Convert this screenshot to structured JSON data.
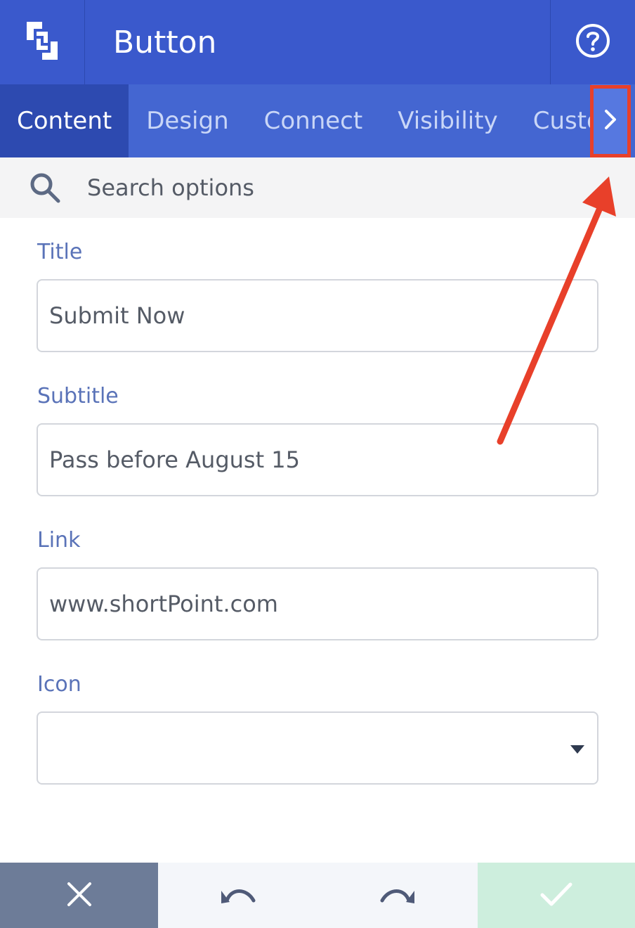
{
  "header": {
    "title": "Button",
    "logo_icon": "shortpoint-logo-icon",
    "help_icon": "help-icon"
  },
  "tabs": [
    {
      "label": "Content",
      "active": true
    },
    {
      "label": "Design",
      "active": false
    },
    {
      "label": "Connect",
      "active": false
    },
    {
      "label": "Visibility",
      "active": false
    },
    {
      "label": "Custo",
      "active": false
    }
  ],
  "tabs_next_icon": "chevron-right-icon",
  "search": {
    "placeholder": "Search options"
  },
  "form": {
    "title": {
      "label": "Title",
      "value": "Submit Now"
    },
    "subtitle": {
      "label": "Subtitle",
      "value": "Pass before August 15"
    },
    "link": {
      "label": "Link",
      "value": "www.shortPoint.com"
    },
    "icon": {
      "label": "Icon",
      "value": ""
    }
  },
  "bottom_bar": {
    "close_icon": "close-icon",
    "undo_icon": "undo-icon",
    "redo_icon": "redo-icon",
    "confirm_icon": "check-icon"
  },
  "colors": {
    "header": "#3a59cc",
    "tabs": "#4466d1",
    "active_tab": "#2d4ab0",
    "annotation": "#e8402a",
    "label": "#5a73b8",
    "close_bg": "#6d7c98",
    "confirm_bg": "#cdeedd"
  }
}
